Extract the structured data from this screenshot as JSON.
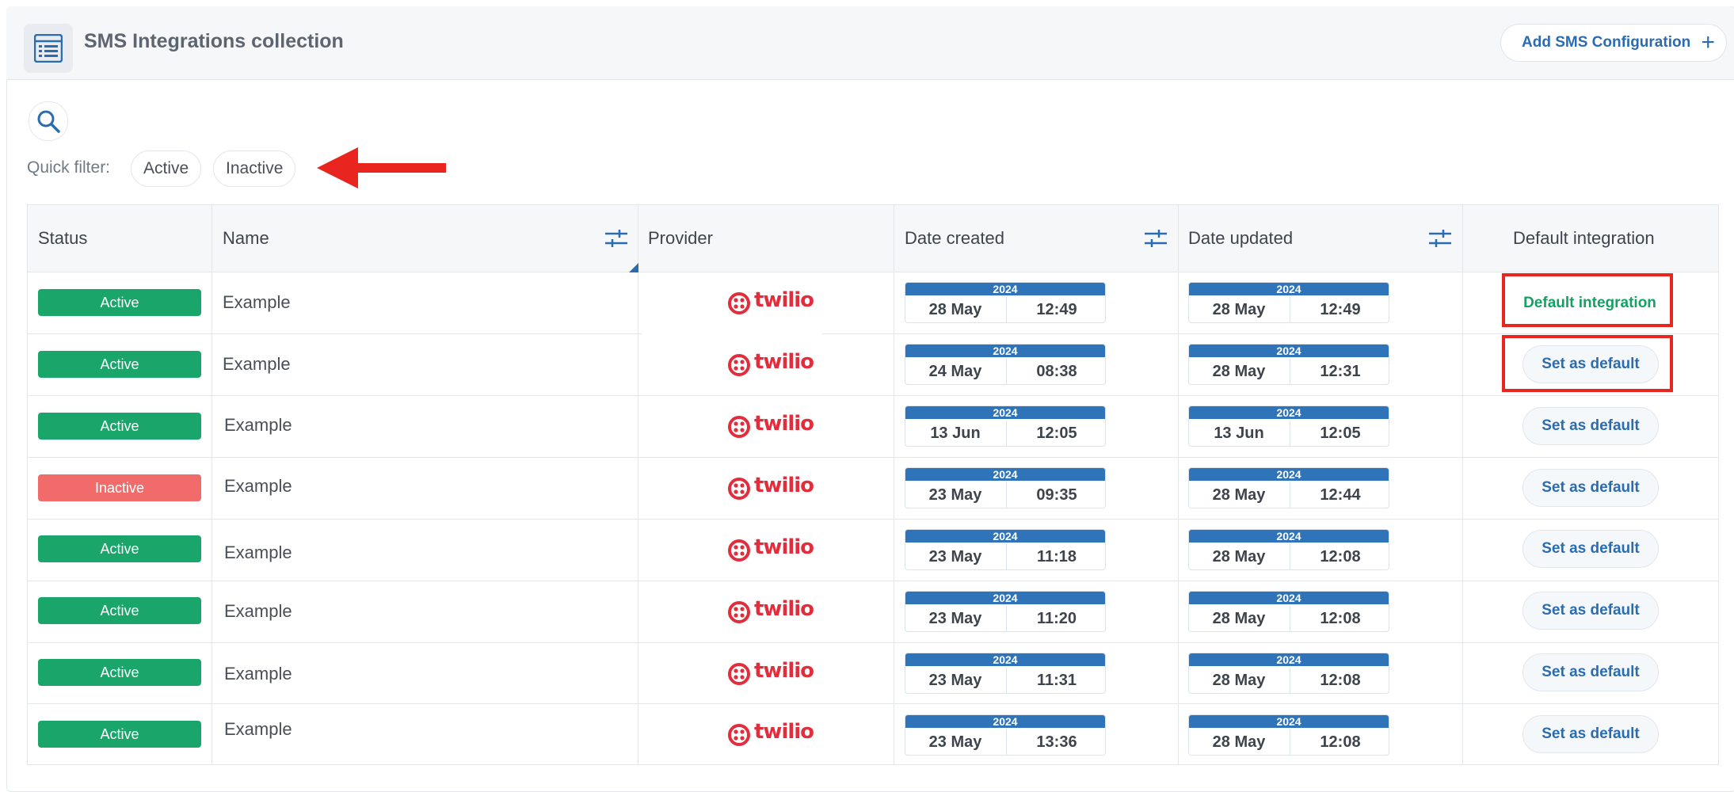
{
  "header": {
    "title": "SMS Integrations collection",
    "add_button_label": "Add SMS Configuration",
    "add_button_icon": "+"
  },
  "quick_filter": {
    "label": "Quick filter:",
    "chips": [
      "Active",
      "Inactive"
    ]
  },
  "table": {
    "columns": [
      "Status",
      "Name",
      "Provider",
      "Date created",
      "Date updated",
      "Default integration"
    ],
    "rows": [
      {
        "status": "Active",
        "name": "Example",
        "provider": "twilio",
        "created": {
          "year": "2024",
          "date": "28 May",
          "time": "12:49"
        },
        "updated": {
          "year": "2024",
          "date": "28 May",
          "time": "12:49"
        },
        "default": "Default integration"
      },
      {
        "status": "Active",
        "name": "Example",
        "provider": "twilio",
        "created": {
          "year": "2024",
          "date": "24 May",
          "time": "08:38"
        },
        "updated": {
          "year": "2024",
          "date": "28 May",
          "time": "12:31"
        },
        "default": "Set as default"
      },
      {
        "status": "Active",
        "name": "Example",
        "provider": "twilio",
        "created": {
          "year": "2024",
          "date": "13 Jun",
          "time": "12:05"
        },
        "updated": {
          "year": "2024",
          "date": "13 Jun",
          "time": "12:05"
        },
        "default": "Set as default"
      },
      {
        "status": "Inactive",
        "name": "Example",
        "provider": "twilio",
        "created": {
          "year": "2024",
          "date": "23 May",
          "time": "09:35"
        },
        "updated": {
          "year": "2024",
          "date": "28 May",
          "time": "12:44"
        },
        "default": "Set as default"
      },
      {
        "status": "Active",
        "name": "Example",
        "provider": "twilio",
        "created": {
          "year": "2024",
          "date": "23 May",
          "time": "11:18"
        },
        "updated": {
          "year": "2024",
          "date": "28 May",
          "time": "12:08"
        },
        "default": "Set as default"
      },
      {
        "status": "Active",
        "name": "Example",
        "provider": "twilio",
        "created": {
          "year": "2024",
          "date": "23 May",
          "time": "11:20"
        },
        "updated": {
          "year": "2024",
          "date": "28 May",
          "time": "12:08"
        },
        "default": "Set as default"
      },
      {
        "status": "Active",
        "name": "Example",
        "provider": "twilio",
        "created": {
          "year": "2024",
          "date": "23 May",
          "time": "11:31"
        },
        "updated": {
          "year": "2024",
          "date": "28 May",
          "time": "12:08"
        },
        "default": "Set as default"
      },
      {
        "status": "Active",
        "name": "Example",
        "provider": "twilio",
        "created": {
          "year": "2024",
          "date": "23 May",
          "time": "13:36"
        },
        "updated": {
          "year": "2024",
          "date": "28 May",
          "time": "12:08"
        },
        "default": "Set as default"
      }
    ]
  },
  "colors": {
    "active": "#1aa56b",
    "inactive": "#f26b6b",
    "accent": "#2b6cb0",
    "twilio": "#e22d3c",
    "annotation": "#e8261f"
  },
  "icons": {
    "app": "list-icon",
    "search": "search-icon",
    "filter": "sliders-icon",
    "provider": "twilio-logo"
  }
}
